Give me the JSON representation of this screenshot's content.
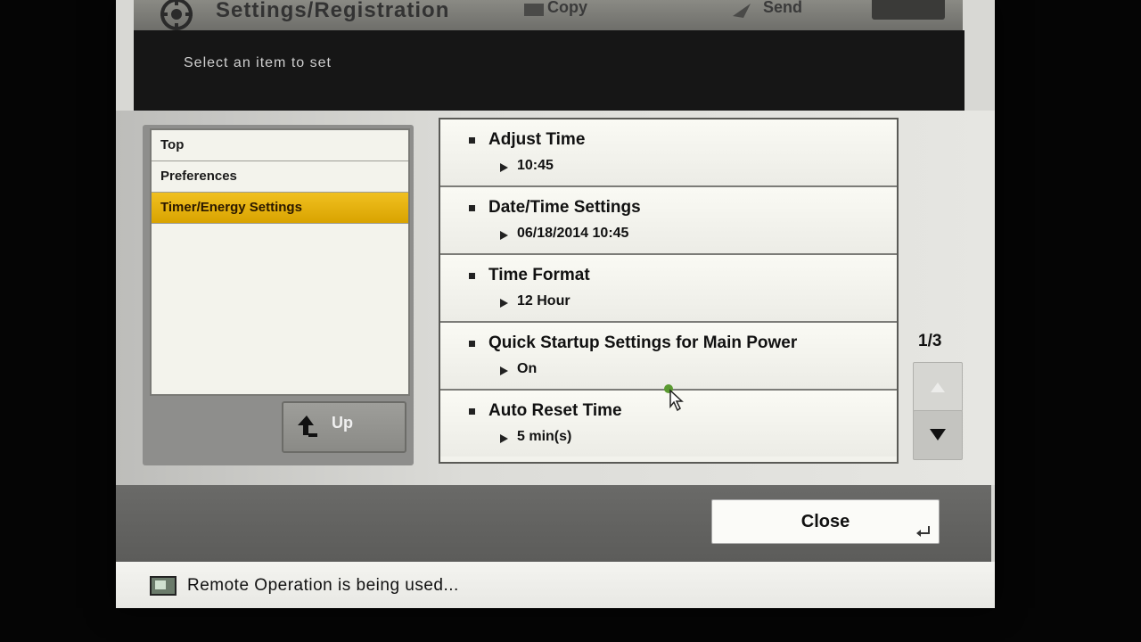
{
  "header": {
    "title": "Settings/Registration",
    "nav": [
      {
        "label": "Copy"
      },
      {
        "label": "Send"
      }
    ]
  },
  "instruction": "Select an item to set",
  "tree": [
    {
      "label": "Top",
      "selected": false
    },
    {
      "label": "Preferences",
      "selected": false
    },
    {
      "label": "Timer/Energy Settings",
      "selected": true
    }
  ],
  "up_button": {
    "label": "Up"
  },
  "items": [
    {
      "label": "Adjust Time",
      "value": "10:45"
    },
    {
      "label": "Date/Time Settings",
      "value": "06/18/2014 10:45"
    },
    {
      "label": "Time Format",
      "value": "12 Hour"
    },
    {
      "label": "Quick Startup Settings for Main Power",
      "value": "On"
    },
    {
      "label": "Auto Reset Time",
      "value": "5 min(s)"
    }
  ],
  "pagination": {
    "page": "1/3"
  },
  "close_button": {
    "label": "Close"
  },
  "status": {
    "text": "Remote Operation is being used..."
  },
  "colors": {
    "selected_row": "#e0ae10",
    "screen_bg": "#d8d8d4",
    "bottom_bar": "#626260"
  }
}
